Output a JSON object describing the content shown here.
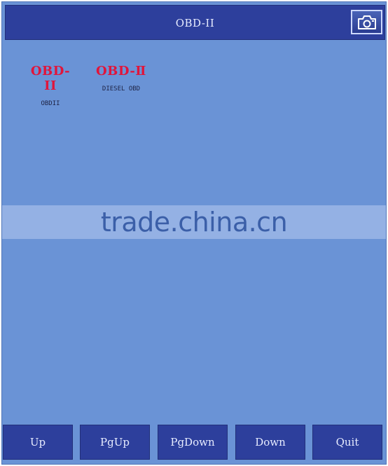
{
  "header": {
    "title": "OBD-II",
    "camera_icon": "camera-icon"
  },
  "apps": [
    {
      "logo": "OBD-II",
      "name": "OBDII"
    },
    {
      "logo": "OBD-Ⅱ",
      "name": "DIESEL OBD"
    }
  ],
  "watermark": "trade.china.cn",
  "footer": {
    "buttons": [
      "Up",
      "PgUp",
      "PgDown",
      "Down",
      "Quit"
    ]
  },
  "colors": {
    "background": "#6a93d6",
    "bar": "#2d3f9c",
    "logo_red": "#e0153b"
  }
}
